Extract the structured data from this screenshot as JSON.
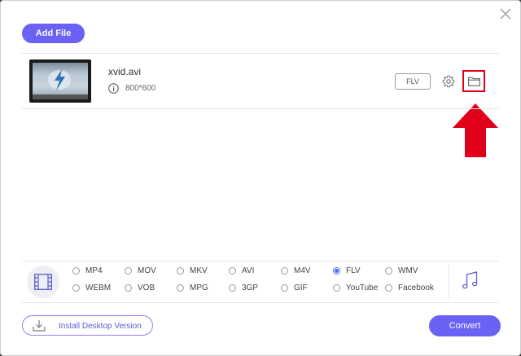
{
  "toolbar": {
    "add_file_label": "Add File"
  },
  "file": {
    "name": "xvid.avi",
    "dimensions": "800*600",
    "output_format": "FLV"
  },
  "formats": {
    "options": [
      {
        "label": "MP4",
        "selected": false
      },
      {
        "label": "MOV",
        "selected": false
      },
      {
        "label": "MKV",
        "selected": false
      },
      {
        "label": "AVI",
        "selected": false
      },
      {
        "label": "M4V",
        "selected": false
      },
      {
        "label": "FLV",
        "selected": true
      },
      {
        "label": "WMV",
        "selected": false
      },
      {
        "label": "WEBM",
        "selected": false
      },
      {
        "label": "VOB",
        "selected": false
      },
      {
        "label": "MPG",
        "selected": false
      },
      {
        "label": "3GP",
        "selected": false
      },
      {
        "label": "GIF",
        "selected": false
      },
      {
        "label": "YouTube",
        "selected": false
      },
      {
        "label": "Facebook",
        "selected": false
      }
    ]
  },
  "footer": {
    "install_label": "Install Desktop Version",
    "convert_label": "Convert"
  },
  "colors": {
    "accent": "#6a62f5",
    "highlight_red": "#e1001a",
    "radio_selected": "#4a6fe8"
  },
  "icons": [
    "close-icon",
    "info-icon",
    "gear-icon",
    "folder-icon",
    "film-icon",
    "music-note-icon",
    "download-icon",
    "red-arrow-up"
  ]
}
